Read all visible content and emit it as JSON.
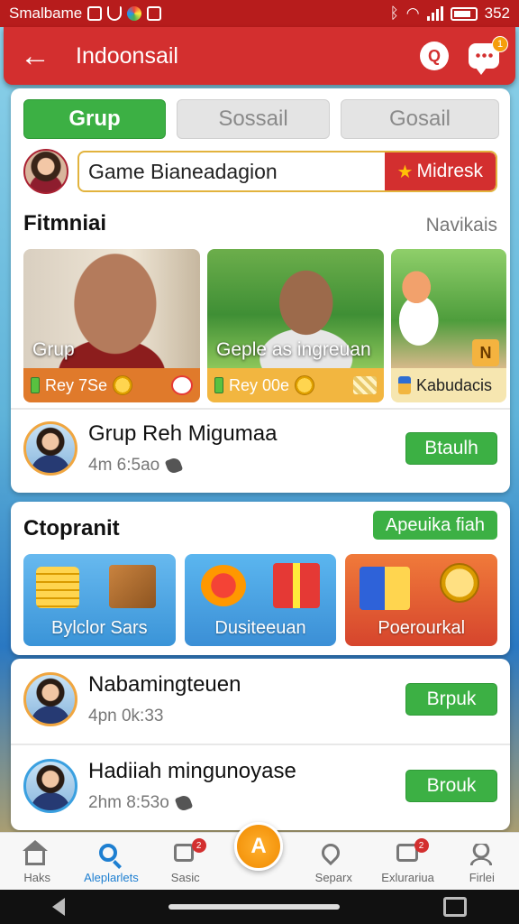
{
  "status_bar": {
    "carrier": "Smalbame",
    "time": "352"
  },
  "app_bar": {
    "title": "Indoonsail",
    "chat_badge": "1"
  },
  "tabs": [
    {
      "label": "Grup",
      "active": true
    },
    {
      "label": "Sossail",
      "active": false
    },
    {
      "label": "Gosail",
      "active": false
    }
  ],
  "search": {
    "value": "Game Bianeadagion",
    "button_label": "Midresk"
  },
  "featured": {
    "title": "Fitmniai",
    "link": "Navikais",
    "items": [
      {
        "caption": "Grup",
        "footer": "Rey 7Se"
      },
      {
        "caption": "Geple as ingreuan",
        "footer": "Rey 00e"
      },
      {
        "caption": "",
        "footer": "Kabudacis",
        "corner_badge": "N"
      }
    ]
  },
  "first_row": {
    "name": "Grup Reh Migumaa",
    "time": "4m 6:5ao",
    "button": "Btaulh"
  },
  "rewards": {
    "title": "Ctopranit",
    "action": "Apeuika fiah",
    "items": [
      {
        "label": "Bylclor Sars"
      },
      {
        "label": "Dusiteeuan"
      },
      {
        "label": "Poerourkal"
      }
    ]
  },
  "rows": [
    {
      "name": "Nabamingteuen",
      "time": "4pn 0k:33",
      "button": "Brpuk"
    },
    {
      "name": "Hadiiah mingunoyase",
      "time": "2hm 8:53o",
      "button": "Brouk"
    }
  ],
  "bottom_nav": {
    "items": [
      {
        "label": "Haks"
      },
      {
        "label": "Aleplarlets",
        "active": true
      },
      {
        "label": "Sasic",
        "badge": "2"
      },
      {
        "label": ""
      },
      {
        "label": "Separx"
      },
      {
        "label": "Exlurariua",
        "badge": "2"
      },
      {
        "label": "Firlei"
      }
    ],
    "center_symbol": "A"
  }
}
